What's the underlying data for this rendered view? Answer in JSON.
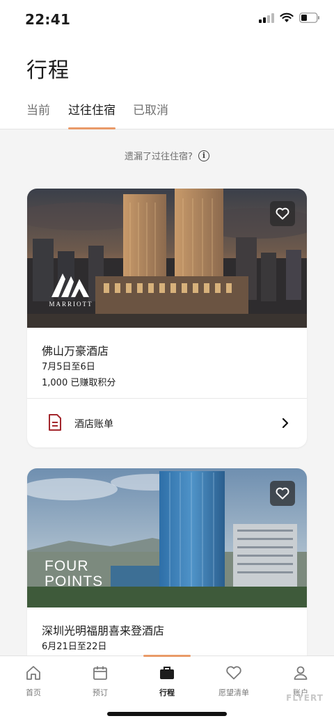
{
  "status_bar": {
    "time": "22:41"
  },
  "header": {
    "title": "行程",
    "tabs": [
      {
        "label": "当前"
      },
      {
        "label": "过往住宿",
        "active": true
      },
      {
        "label": "已取消"
      }
    ]
  },
  "notice": {
    "text": "遗漏了过往住宿?"
  },
  "stays": [
    {
      "brand_logo": "MARRIOTT",
      "name": "佛山万豪酒店",
      "dates": "7月5日至6日",
      "points": "1,000 已赚取积分",
      "folio_label": "酒店账单"
    },
    {
      "brand_logo_line1": "FOUR",
      "brand_logo_line2": "POINTS",
      "name": "深圳光明福朋喜来登酒店",
      "dates": "6月21日至22日"
    }
  ],
  "bottom_nav": [
    {
      "label": "首页",
      "icon": "home-icon"
    },
    {
      "label": "预订",
      "icon": "calendar-icon"
    },
    {
      "label": "行程",
      "icon": "briefcase-icon",
      "active": true
    },
    {
      "label": "愿望清单",
      "icon": "heart-icon"
    },
    {
      "label": "账户",
      "icon": "person-icon"
    }
  ],
  "watermark": "FLYERT",
  "colors": {
    "accent": "#e99a68",
    "folio_icon": "#a3262c"
  }
}
